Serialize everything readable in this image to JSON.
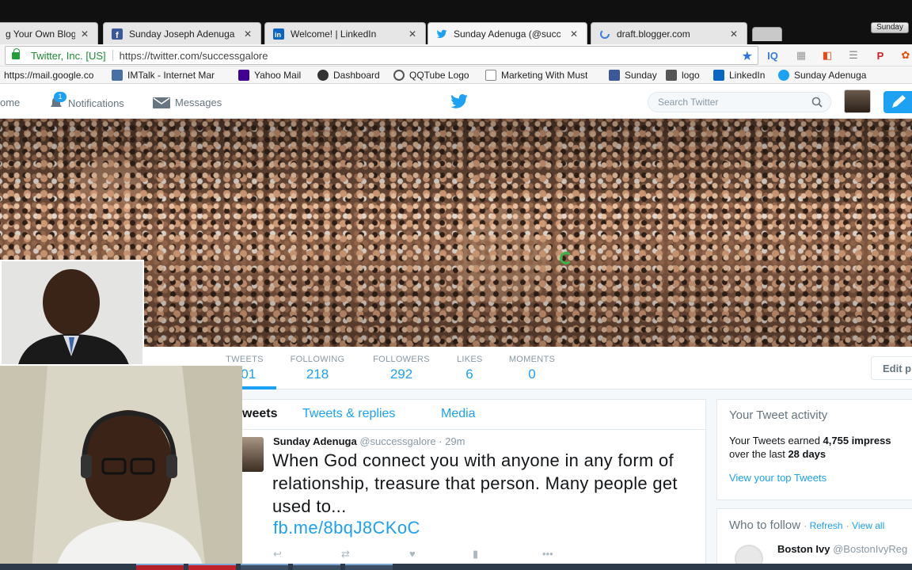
{
  "browser": {
    "tabs": [
      {
        "title": "g Your Own Blog",
        "icon": "blogger-icon",
        "active": false
      },
      {
        "title": "Sunday Joseph Adenuga",
        "icon": "facebook-icon",
        "active": false
      },
      {
        "title": "Welcome! | LinkedIn",
        "icon": "linkedin-icon",
        "active": false
      },
      {
        "title": "Sunday Adenuga (@succ",
        "icon": "twitter-icon",
        "active": true
      },
      {
        "title": "draft.blogger.com",
        "icon": "loading-icon",
        "active": false
      }
    ],
    "profile_name": "Sunday",
    "secure_label": "Twitter, Inc. [US]",
    "url": "https://twitter.com/successgalore",
    "bookmarks": [
      {
        "label": "https://mail.google.co",
        "icon": "page-icon"
      },
      {
        "label": "IMTalk - Internet Mar",
        "icon": "imtalk-icon"
      },
      {
        "label": "Yahoo Mail",
        "icon": "mail-icon"
      },
      {
        "label": "Dashboard",
        "icon": "dashboard-icon"
      },
      {
        "label": "QQTube Logo",
        "icon": "search-icon"
      },
      {
        "label": "Marketing With Must",
        "icon": "page-icon"
      },
      {
        "label": "Sunday",
        "icon": "facebook-icon"
      },
      {
        "label": "logo",
        "icon": "image-icon"
      },
      {
        "label": "LinkedIn",
        "icon": "linkedin-icon"
      },
      {
        "label": "Sunday Adenuga",
        "icon": "twitter-icon"
      }
    ]
  },
  "twitter_nav": {
    "home": "ome",
    "notifications": "Notifications",
    "notifications_count": "1",
    "messages": "Messages",
    "search_placeholder": "Search Twitter"
  },
  "profile_nav": {
    "stats": [
      {
        "label": "TWEETS",
        "value": "901"
      },
      {
        "label": "FOLLOWING",
        "value": "218"
      },
      {
        "label": "FOLLOWERS",
        "value": "292"
      },
      {
        "label": "LIKES",
        "value": "6"
      },
      {
        "label": "MOMENTS",
        "value": "0"
      }
    ],
    "edit_button": "Edit p"
  },
  "timeline": {
    "tabs": [
      "weets",
      "Tweets & replies",
      "Media"
    ],
    "tweet": {
      "name": "Sunday Adenuga",
      "meta": "@successgalore · 29m",
      "text": "When God connect you with anyone in any form of relationship, treasure that person. Many people get used to...",
      "link": "fb.me/8bqJ8CKoC"
    }
  },
  "sidebar": {
    "activity_title": "Your Tweet activity",
    "activity_line1_prefix": "Your Tweets earned ",
    "activity_line1_bold": "4,755 impress",
    "activity_line2_prefix": "over the last ",
    "activity_line2_bold": "28 days",
    "activity_link": "View your top Tweets",
    "wtf_title": "Who to follow",
    "wtf_refresh": "Refresh",
    "wtf_viewall": "View all",
    "wtf_user_name": "Boston Ivy",
    "wtf_user_handle": "@BostonIvyReg"
  },
  "colors": {
    "twitter_blue": "#1da1f2",
    "secure_green": "#1e8a35"
  }
}
